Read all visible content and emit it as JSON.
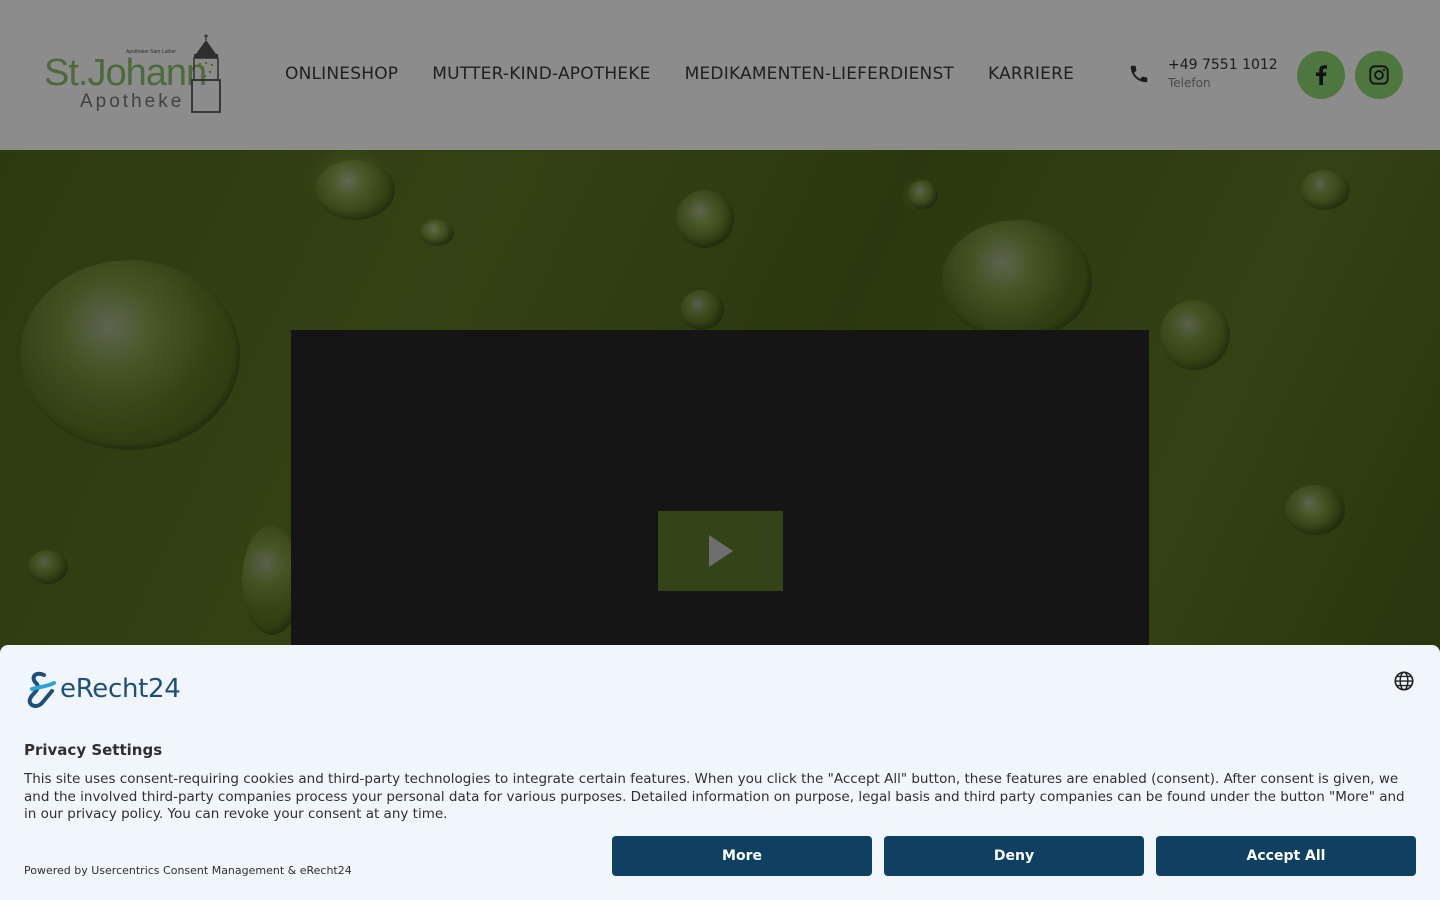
{
  "logo": {
    "tagline": "Apotheker Sam Luther",
    "name_line1": "St.Johann",
    "name_line2": "Apotheke"
  },
  "nav": {
    "items": [
      {
        "label": "ONLINESHOP"
      },
      {
        "label": "MUTTER-KIND-APOTHEKE"
      },
      {
        "label": "MEDIKAMENTEN-LIEFERDIENST"
      },
      {
        "label": "KARRIERE"
      }
    ]
  },
  "contact": {
    "phone_number": "+49 7551 1012",
    "phone_label": "Telefon"
  },
  "social": {
    "facebook_icon": "facebook-icon",
    "instagram_icon": "instagram-icon"
  },
  "colors": {
    "accent_green": "#8ed774",
    "button_navy": "#0f4062",
    "play_green": "#5c7c2c"
  },
  "consent": {
    "brand": "eRecht24",
    "title": "Privacy Settings",
    "body": "This site uses consent-requiring cookies and third-party technologies to integrate certain features. When you click the \"Accept All\" button, these features are enabled (consent). After consent is given, we and the involved third-party companies process your personal data for various purposes. Detailed information on purpose, legal basis and third party companies can be found under the button \"More\" and in our privacy policy. You can revoke your consent at any time.",
    "powered_by": "Powered by Usercentrics Consent Management & eRecht24",
    "buttons": {
      "more": "More",
      "deny": "Deny",
      "accept_all": "Accept All"
    }
  }
}
